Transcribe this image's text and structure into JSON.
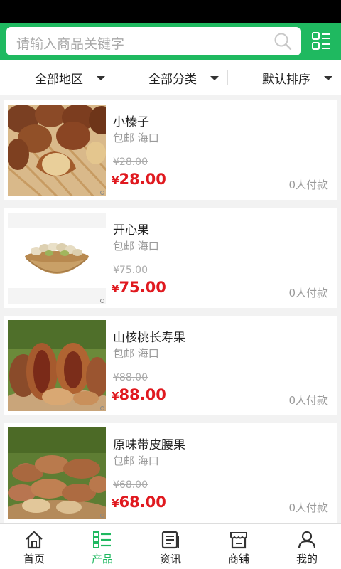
{
  "search": {
    "placeholder": "请输入商品关键字"
  },
  "icons": {
    "search": "search-icon",
    "menu": "grid-list-icon"
  },
  "colors": {
    "brand": "#1fb960",
    "price": "#e0191f"
  },
  "filters": [
    {
      "label": "全部地区"
    },
    {
      "label": "全部分类"
    },
    {
      "label": "默认排序"
    }
  ],
  "products": [
    {
      "title": "小榛子",
      "shipping": "包邮 海口",
      "old_price": "¥28.00",
      "price_symbol": "¥",
      "price": "28.00",
      "sales": "0人付款"
    },
    {
      "title": "开心果",
      "shipping": "包邮 海口",
      "old_price": "¥75.00",
      "price_symbol": "¥",
      "price": "75.00",
      "sales": "0人付款"
    },
    {
      "title": "山核桃长寿果",
      "shipping": "包邮 海口",
      "old_price": "¥88.00",
      "price_symbol": "¥",
      "price": "88.00",
      "sales": "0人付款"
    },
    {
      "title": "原味带皮腰果",
      "shipping": "包邮 海口",
      "old_price": "¥68.00",
      "price_symbol": "¥",
      "price": "68.00",
      "sales": "0人付款"
    }
  ],
  "tabs": [
    {
      "label": "首页",
      "icon": "home-icon"
    },
    {
      "label": "产品",
      "icon": "product-list-icon",
      "active": true
    },
    {
      "label": "资讯",
      "icon": "news-icon"
    },
    {
      "label": "商铺",
      "icon": "shop-icon"
    },
    {
      "label": "我的",
      "icon": "user-icon"
    }
  ]
}
